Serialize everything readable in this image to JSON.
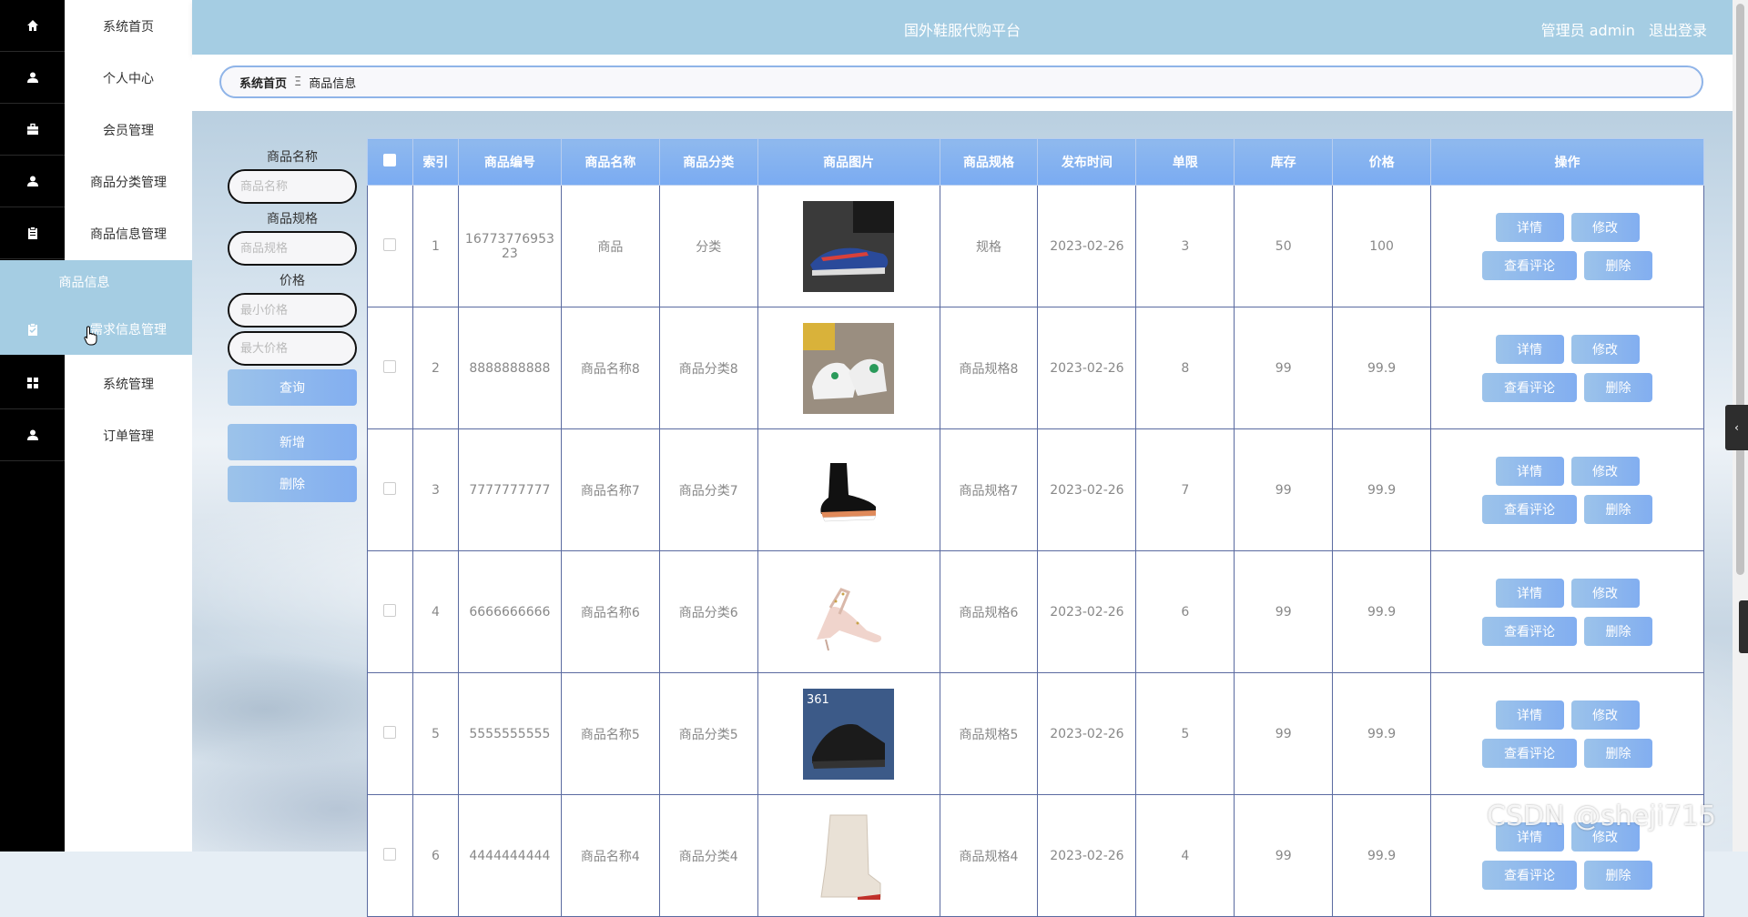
{
  "app": {
    "title": "国外鞋服代购平台",
    "user_label": "管理员 admin",
    "logout_label": "退出登录"
  },
  "menu": {
    "items": [
      {
        "label": "系统首页",
        "icon": "home-icon"
      },
      {
        "label": "个人中心",
        "icon": "user-icon"
      },
      {
        "label": "会员管理",
        "icon": "briefcase-icon"
      },
      {
        "label": "商品分类管理",
        "icon": "user-icon"
      },
      {
        "label": "商品信息管理",
        "icon": "clipboard-icon"
      },
      {
        "label": "需求信息管理",
        "icon": "clipboard-icon"
      },
      {
        "label": "系统管理",
        "icon": "grid-icon"
      },
      {
        "label": "订单管理",
        "icon": "user-icon"
      }
    ],
    "submenu_label": "商品信息"
  },
  "breadcrumb": {
    "home": "系统首页",
    "separator": "Ξ",
    "current": "商品信息"
  },
  "search": {
    "name_label": "商品名称",
    "name_placeholder": "商品名称",
    "spec_label": "商品规格",
    "spec_placeholder": "商品规格",
    "price_label": "价格",
    "min_placeholder": "最小价格",
    "max_placeholder": "最大价格",
    "query_button": "查询",
    "add_button": "新增",
    "delete_button": "删除"
  },
  "table": {
    "headers": [
      "索引",
      "商品编号",
      "商品名称",
      "商品分类",
      "商品图片",
      "商品规格",
      "发布时间",
      "单限",
      "库存",
      "价格",
      "操作"
    ],
    "actions": {
      "detail": "详情",
      "edit": "修改",
      "comments": "查看评论",
      "delete": "删除"
    },
    "rows": [
      {
        "index": "1",
        "code": "16773776953 23",
        "name": "商品",
        "category": "分类",
        "image": "sneaker-red-blue-icon",
        "spec": "规格",
        "date": "2023-02-26",
        "limit": "3",
        "stock": "50",
        "price": "100"
      },
      {
        "index": "2",
        "code": "8888888888",
        "name": "商品名称8",
        "category": "商品分类8",
        "image": "sneaker-white-green-icon",
        "spec": "商品规格8",
        "date": "2023-02-26",
        "limit": "8",
        "stock": "99",
        "price": "99.9"
      },
      {
        "index": "3",
        "code": "7777777777",
        "name": "商品名称7",
        "category": "商品分类7",
        "image": "sock-sneaker-black-icon",
        "spec": "商品规格7",
        "date": "2023-02-26",
        "limit": "7",
        "stock": "99",
        "price": "99.9"
      },
      {
        "index": "4",
        "code": "6666666666",
        "name": "商品名称6",
        "category": "商品分类6",
        "image": "studded-heel-pink-icon",
        "spec": "商品规格6",
        "date": "2023-02-26",
        "limit": "6",
        "stock": "99",
        "price": "99.9"
      },
      {
        "index": "5",
        "code": "5555555555",
        "name": "商品名称5",
        "category": "商品分类5",
        "image": "sneaker-black-361-icon",
        "spec": "商品规格5",
        "date": "2023-02-26",
        "limit": "5",
        "stock": "99",
        "price": "99.9"
      },
      {
        "index": "6",
        "code": "4444444444",
        "name": "商品名称4",
        "category": "商品分类4",
        "image": "boot-white-icon",
        "spec": "商品规格4",
        "date": "2023-02-26",
        "limit": "4",
        "stock": "99",
        "price": "99.9"
      }
    ]
  },
  "watermark": "CSDN @sheji715",
  "colors": {
    "accent": "#a5cde3",
    "button": "#82aef0",
    "header": "#7aabf2",
    "sidebar": "#000000"
  }
}
